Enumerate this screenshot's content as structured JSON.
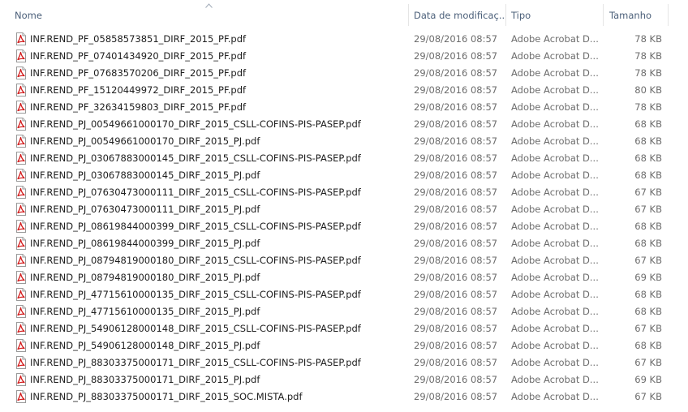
{
  "columns": {
    "name": "Nome",
    "date": "Data de modificaç...",
    "type": "Tipo",
    "size": "Tamanho"
  },
  "accent_colors": {
    "header_text": "#4c607a",
    "pdf_icon_red": "#d21b1b",
    "secondary_text": "#6d6d6d"
  },
  "file_icon": "pdf-file-icon",
  "files": [
    {
      "name": "INF.REND_PF_05858573851_DIRF_2015_PF.pdf",
      "date": "29/08/2016 08:57",
      "type": "Adobe Acrobat D...",
      "size": "78 KB"
    },
    {
      "name": "INF.REND_PF_07401434920_DIRF_2015_PF.pdf",
      "date": "29/08/2016 08:57",
      "type": "Adobe Acrobat D...",
      "size": "78 KB"
    },
    {
      "name": "INF.REND_PF_07683570206_DIRF_2015_PF.pdf",
      "date": "29/08/2016 08:57",
      "type": "Adobe Acrobat D...",
      "size": "78 KB"
    },
    {
      "name": "INF.REND_PF_15120449972_DIRF_2015_PF.pdf",
      "date": "29/08/2016 08:57",
      "type": "Adobe Acrobat D...",
      "size": "80 KB"
    },
    {
      "name": "INF.REND_PF_32634159803_DIRF_2015_PF.pdf",
      "date": "29/08/2016 08:57",
      "type": "Adobe Acrobat D...",
      "size": "78 KB"
    },
    {
      "name": "INF.REND_PJ_00549661000170_DIRF_2015_CSLL-COFINS-PIS-PASEP.pdf",
      "date": "29/08/2016 08:57",
      "type": "Adobe Acrobat D...",
      "size": "68 KB"
    },
    {
      "name": "INF.REND_PJ_00549661000170_DIRF_2015_PJ.pdf",
      "date": "29/08/2016 08:57",
      "type": "Adobe Acrobat D...",
      "size": "68 KB"
    },
    {
      "name": "INF.REND_PJ_03067883000145_DIRF_2015_CSLL-COFINS-PIS-PASEP.pdf",
      "date": "29/08/2016 08:57",
      "type": "Adobe Acrobat D...",
      "size": "68 KB"
    },
    {
      "name": "INF.REND_PJ_03067883000145_DIRF_2015_PJ.pdf",
      "date": "29/08/2016 08:57",
      "type": "Adobe Acrobat D...",
      "size": "68 KB"
    },
    {
      "name": "INF.REND_PJ_07630473000111_DIRF_2015_CSLL-COFINS-PIS-PASEP.pdf",
      "date": "29/08/2016 08:57",
      "type": "Adobe Acrobat D...",
      "size": "67 KB"
    },
    {
      "name": "INF.REND_PJ_07630473000111_DIRF_2015_PJ.pdf",
      "date": "29/08/2016 08:57",
      "type": "Adobe Acrobat D...",
      "size": "67 KB"
    },
    {
      "name": "INF.REND_PJ_08619844000399_DIRF_2015_CSLL-COFINS-PIS-PASEP.pdf",
      "date": "29/08/2016 08:57",
      "type": "Adobe Acrobat D...",
      "size": "68 KB"
    },
    {
      "name": "INF.REND_PJ_08619844000399_DIRF_2015_PJ.pdf",
      "date": "29/08/2016 08:57",
      "type": "Adobe Acrobat D...",
      "size": "68 KB"
    },
    {
      "name": "INF.REND_PJ_08794819000180_DIRF_2015_CSLL-COFINS-PIS-PASEP.pdf",
      "date": "29/08/2016 08:57",
      "type": "Adobe Acrobat D...",
      "size": "67 KB"
    },
    {
      "name": "INF.REND_PJ_08794819000180_DIRF_2015_PJ.pdf",
      "date": "29/08/2016 08:57",
      "type": "Adobe Acrobat D...",
      "size": "69 KB"
    },
    {
      "name": "INF.REND_PJ_47715610000135_DIRF_2015_CSLL-COFINS-PIS-PASEP.pdf",
      "date": "29/08/2016 08:57",
      "type": "Adobe Acrobat D...",
      "size": "68 KB"
    },
    {
      "name": "INF.REND_PJ_47715610000135_DIRF_2015_PJ.pdf",
      "date": "29/08/2016 08:57",
      "type": "Adobe Acrobat D...",
      "size": "68 KB"
    },
    {
      "name": "INF.REND_PJ_54906128000148_DIRF_2015_CSLL-COFINS-PIS-PASEP.pdf",
      "date": "29/08/2016 08:57",
      "type": "Adobe Acrobat D...",
      "size": "67 KB"
    },
    {
      "name": "INF.REND_PJ_54906128000148_DIRF_2015_PJ.pdf",
      "date": "29/08/2016 08:57",
      "type": "Adobe Acrobat D...",
      "size": "68 KB"
    },
    {
      "name": "INF.REND_PJ_88303375000171_DIRF_2015_CSLL-COFINS-PIS-PASEP.pdf",
      "date": "29/08/2016 08:57",
      "type": "Adobe Acrobat D...",
      "size": "67 KB"
    },
    {
      "name": "INF.REND_PJ_88303375000171_DIRF_2015_PJ.pdf",
      "date": "29/08/2016 08:57",
      "type": "Adobe Acrobat D...",
      "size": "69 KB"
    },
    {
      "name": "INF.REND_PJ_88303375000171_DIRF_2015_SOC.MISTA.pdf",
      "date": "29/08/2016 08:57",
      "type": "Adobe Acrobat D...",
      "size": "67 KB"
    }
  ]
}
